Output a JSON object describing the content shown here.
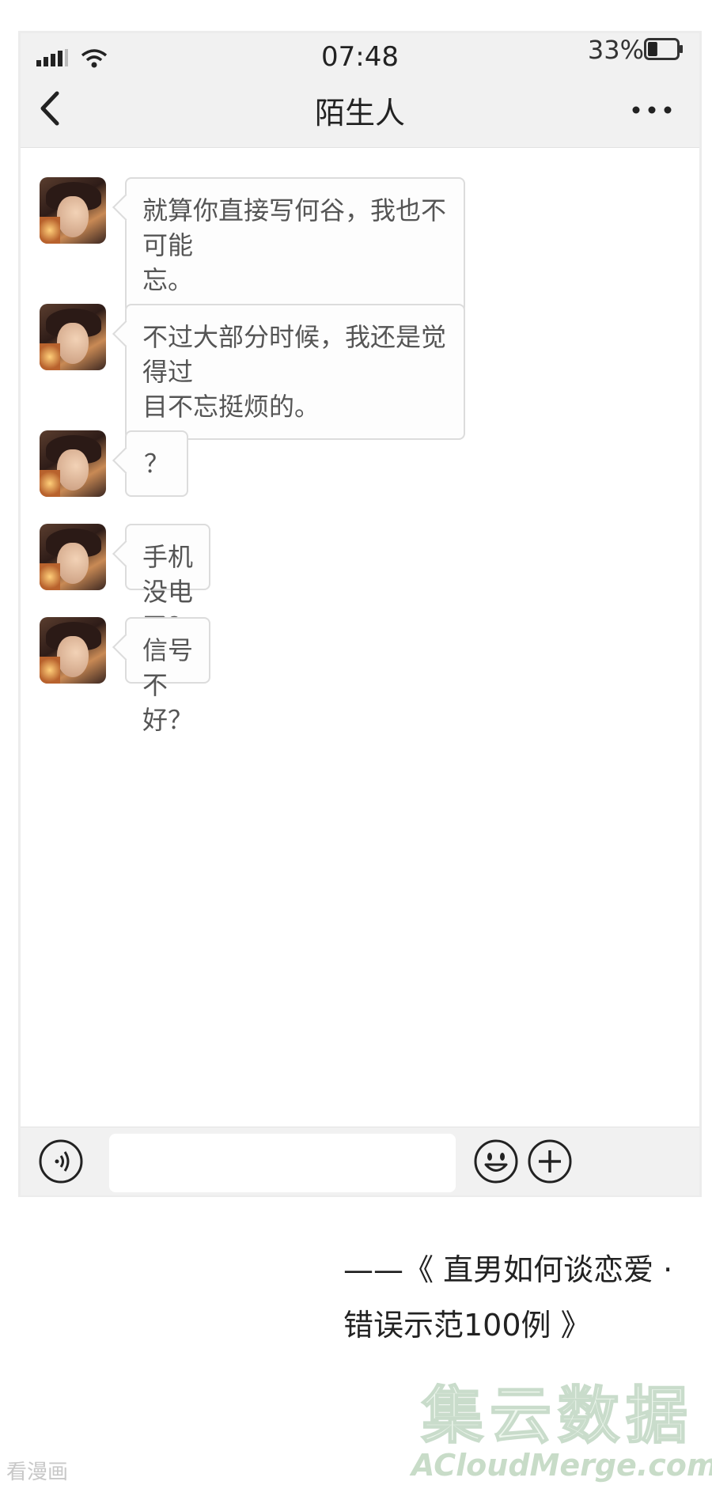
{
  "status_bar": {
    "time": "07:48",
    "battery_percent": "33%",
    "battery_level": 0.33
  },
  "header": {
    "title": "陌生人"
  },
  "icons": {
    "back": "chevron-left-icon",
    "more": "more-dots-icon",
    "voice": "voice-icon",
    "emoji": "emoji-icon",
    "add": "plus-icon",
    "signal": "signal-icon",
    "wifi": "wifi-icon",
    "battery": "battery-icon"
  },
  "messages": [
    {
      "text": "就算你直接写何谷，我也不可能\n忘。"
    },
    {
      "text": "不过大部分时候，我还是觉得过\n目不忘挺烦的。"
    },
    {
      "text": "？"
    },
    {
      "text": "手机没电了？"
    },
    {
      "text": "信号不好？"
    }
  ],
  "input": {
    "value": ""
  },
  "caption": {
    "line1": "——《 直男如何谈恋爱 ·",
    "line2": "错误示范100例 》"
  },
  "watermark": {
    "cn": "集云数据",
    "en": "ACloudMerge.com"
  },
  "site_mark": "看漫画",
  "colors": {
    "header_bg": "#f1f1f1",
    "bubble_border": "#dcdcdc",
    "bubble_bg": "#fdfdfd"
  }
}
